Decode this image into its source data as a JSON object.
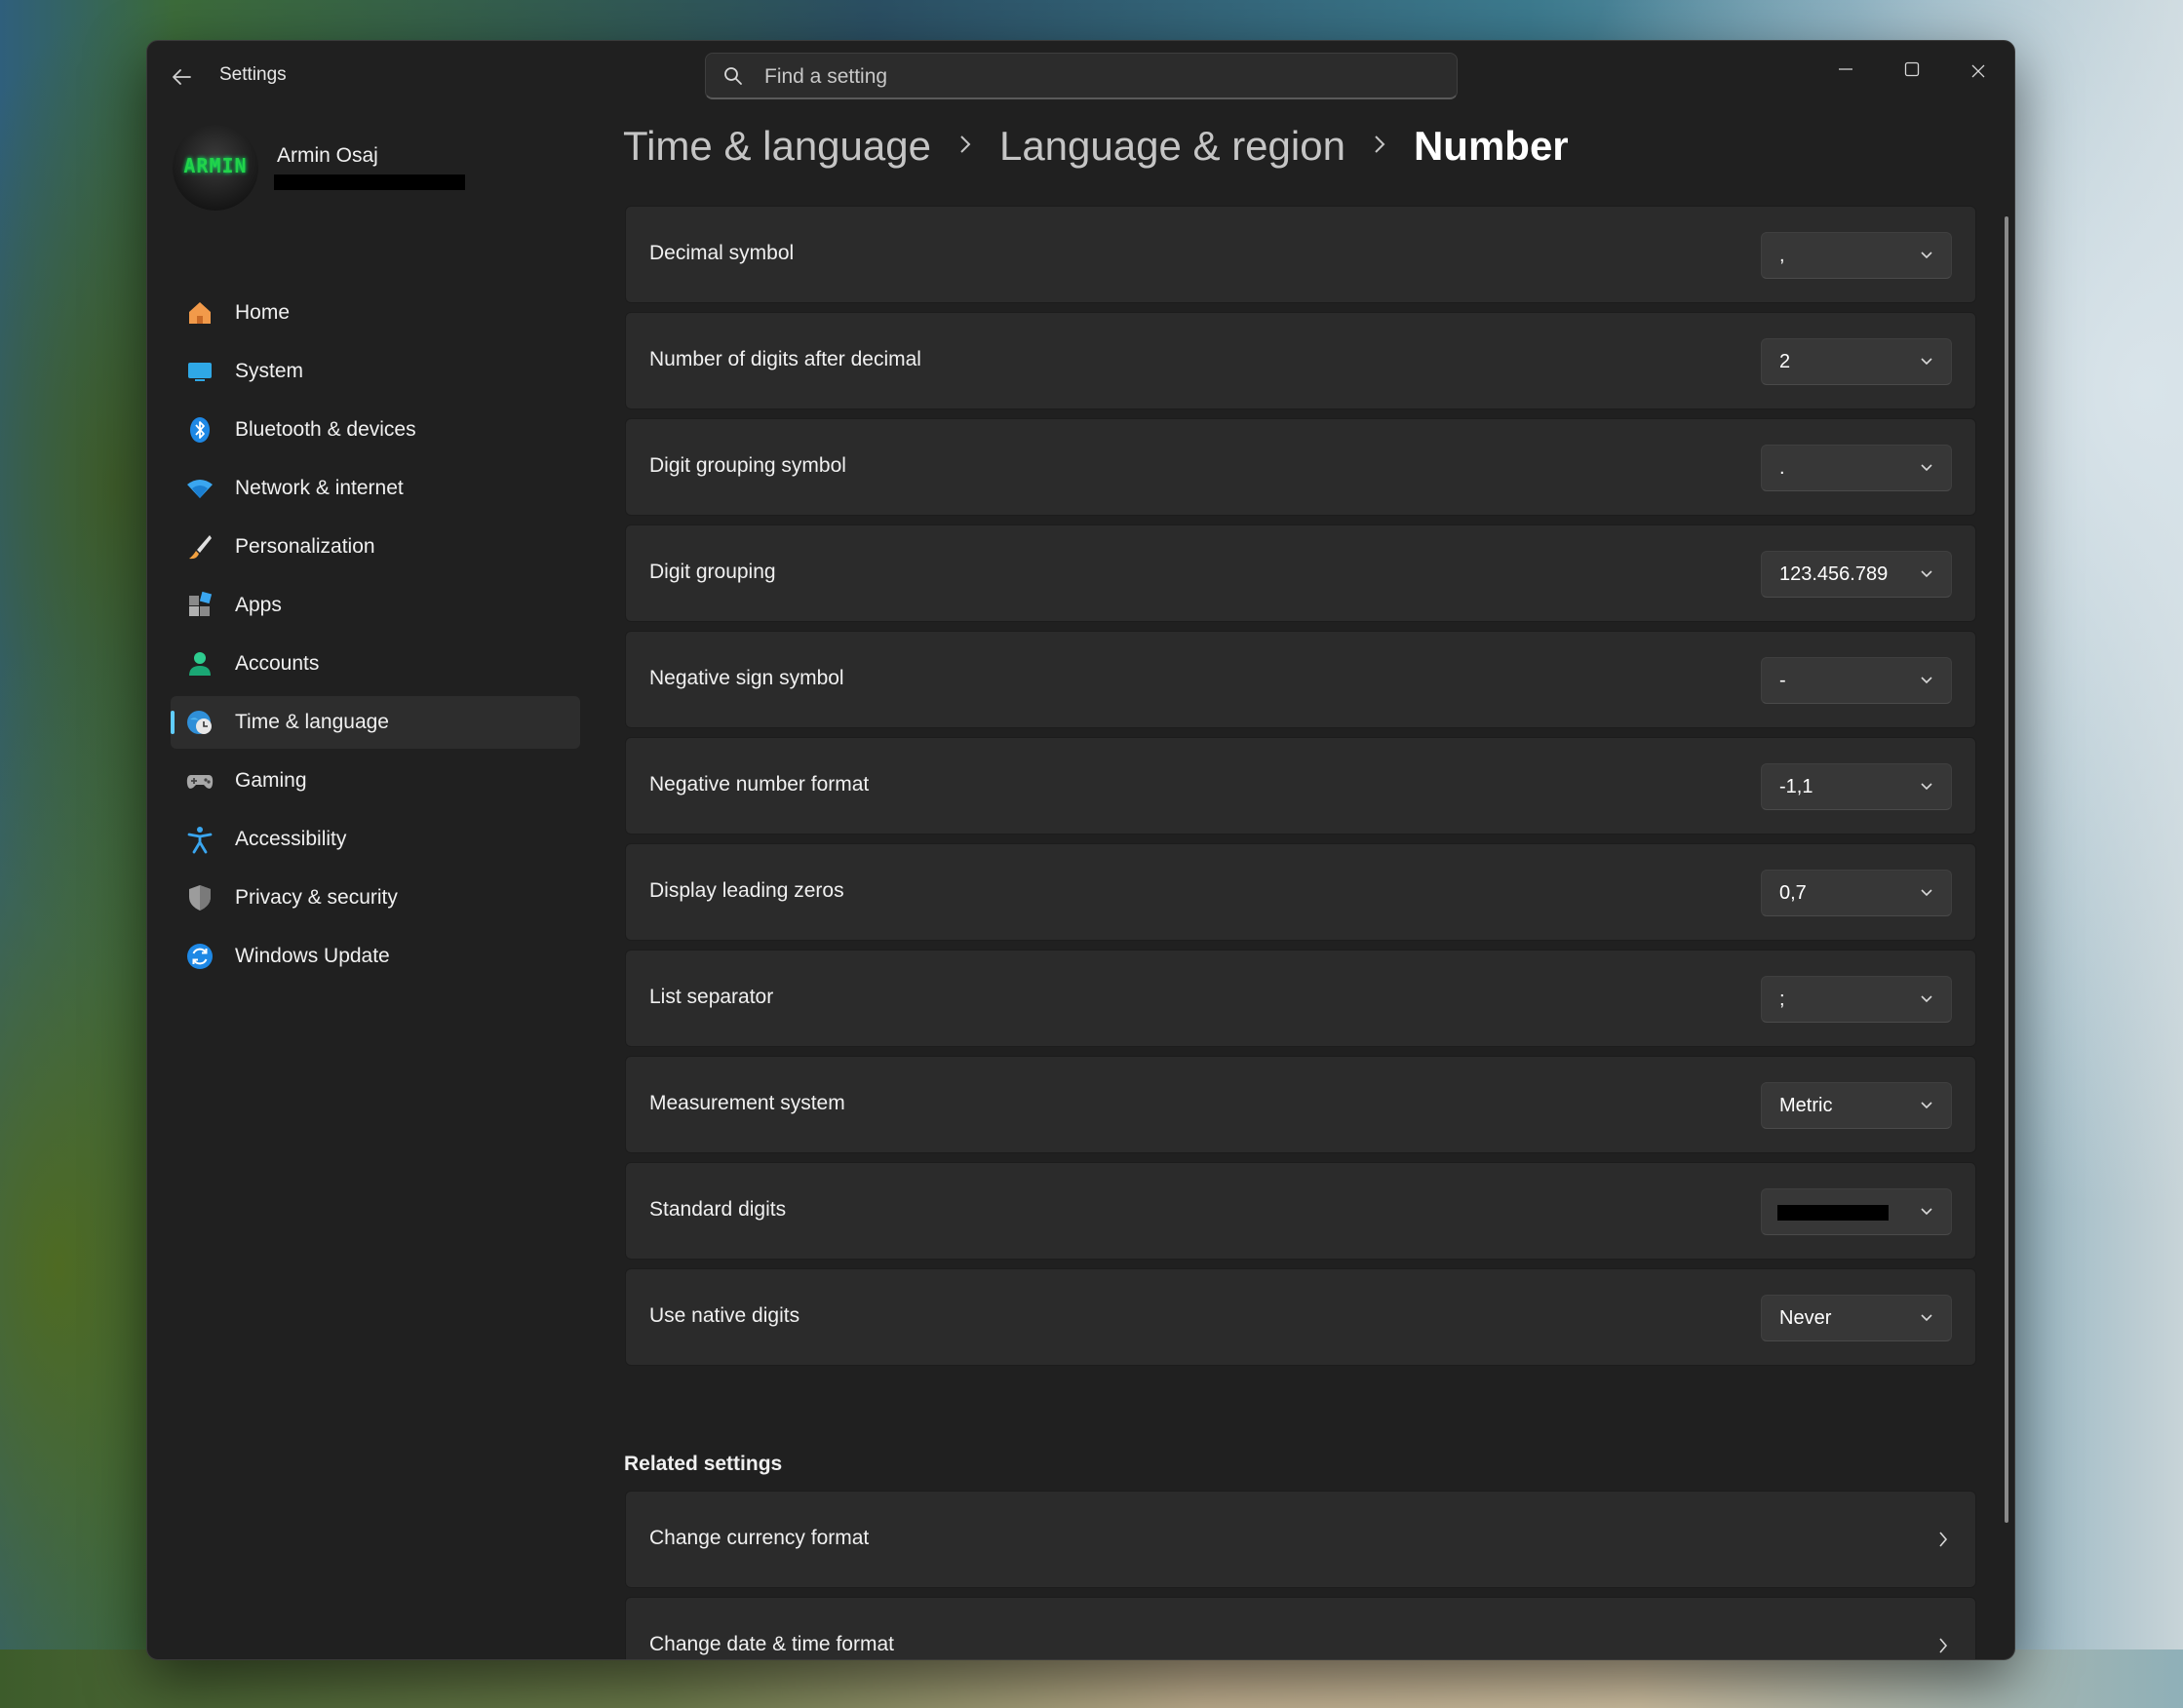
{
  "window": {
    "app_title": "Settings"
  },
  "search": {
    "placeholder": "Find a setting",
    "value": ""
  },
  "profile": {
    "avatar_text": "ARMIN",
    "name": "Armin Osaj"
  },
  "sidebar": {
    "items": [
      {
        "label": "Home",
        "icon": "home-icon",
        "active": false
      },
      {
        "label": "System",
        "icon": "system-icon",
        "active": false
      },
      {
        "label": "Bluetooth & devices",
        "icon": "bluetooth-icon",
        "active": false
      },
      {
        "label": "Network & internet",
        "icon": "wifi-icon",
        "active": false
      },
      {
        "label": "Personalization",
        "icon": "brush-icon",
        "active": false
      },
      {
        "label": "Apps",
        "icon": "apps-icon",
        "active": false
      },
      {
        "label": "Accounts",
        "icon": "person-icon",
        "active": false
      },
      {
        "label": "Time & language",
        "icon": "globe-clock-icon",
        "active": true
      },
      {
        "label": "Gaming",
        "icon": "gamepad-icon",
        "active": false
      },
      {
        "label": "Accessibility",
        "icon": "accessibility-icon",
        "active": false
      },
      {
        "label": "Privacy & security",
        "icon": "shield-icon",
        "active": false
      },
      {
        "label": "Windows Update",
        "icon": "update-icon",
        "active": false
      }
    ]
  },
  "breadcrumb": {
    "items": [
      "Time & language",
      "Language & region"
    ],
    "current": "Number"
  },
  "settings": [
    {
      "label": "Decimal symbol",
      "value": ","
    },
    {
      "label": "Number of digits after decimal",
      "value": "2"
    },
    {
      "label": "Digit grouping symbol",
      "value": "."
    },
    {
      "label": "Digit grouping",
      "value": "123.456.789"
    },
    {
      "label": "Negative sign symbol",
      "value": "-"
    },
    {
      "label": "Negative number format",
      "value": "-1,1"
    },
    {
      "label": "Display leading zeros",
      "value": "0,7"
    },
    {
      "label": "List separator",
      "value": ";"
    },
    {
      "label": "Measurement system",
      "value": "Metric"
    },
    {
      "label": "Standard digits",
      "value": ""
    },
    {
      "label": "Use native digits",
      "value": "Never"
    }
  ],
  "related": {
    "title": "Related settings",
    "items": [
      {
        "label": "Change currency format"
      },
      {
        "label": "Change date & time format"
      }
    ]
  },
  "colors": {
    "accent": "#60cdff",
    "window_bg": "#202020",
    "card_bg": "#2b2b2b"
  }
}
